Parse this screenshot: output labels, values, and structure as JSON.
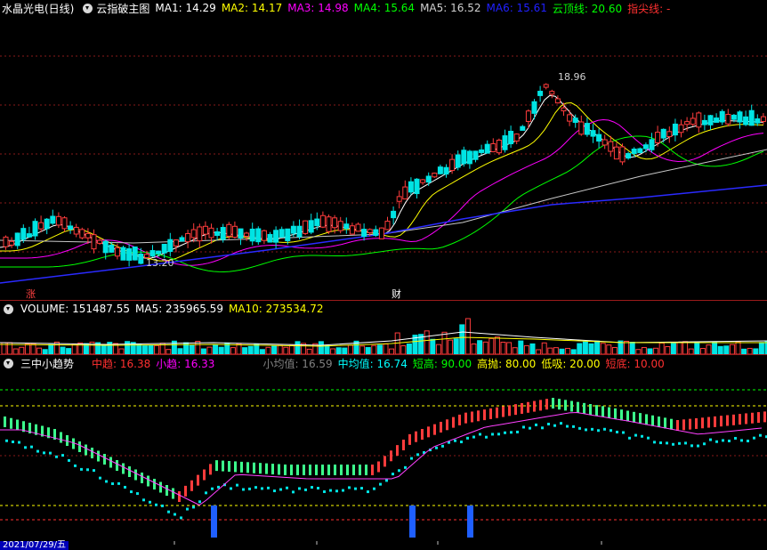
{
  "header": {
    "stock_name": "水晶光电(日线)",
    "indicator_name": "云指破主图",
    "items": [
      {
        "label": "MA1: 14.29",
        "color": "#ffffff"
      },
      {
        "label": "MA2: 14.17",
        "color": "#ffff00"
      },
      {
        "label": "MA3: 14.98",
        "color": "#ff00ff"
      },
      {
        "label": "MA4: 15.64",
        "color": "#00ff00"
      },
      {
        "label": "MA5: 16.52",
        "color": "#d0d0d0"
      },
      {
        "label": "MA6: 15.61",
        "color": "#2020ff"
      },
      {
        "label": "云顶线: 20.60",
        "color": "#00ff00"
      },
      {
        "label": "指尖线: -",
        "color": "#ff3030"
      }
    ]
  },
  "main_chart": {
    "high_label": "18.96",
    "low_label": "13.20",
    "marker_zhang": "涨",
    "marker_cai": "财"
  },
  "volume_panel": {
    "items": [
      {
        "label": "VOLUME: 151487.55",
        "color": "#ffffff"
      },
      {
        "label": "MA5: 235965.59",
        "color": "#ffffff"
      },
      {
        "label": "MA10: 273534.72",
        "color": "#ffff00"
      }
    ]
  },
  "indicator_panel": {
    "name": "三中小趋势",
    "items": [
      {
        "label": "中趋: 16.38",
        "color": "#ff3030"
      },
      {
        "label": "小趋: 16.33",
        "color": "#ff00ff"
      },
      {
        "label": "小均值: 16.59",
        "color": "#808080"
      },
      {
        "label": "中均值: 16.74",
        "color": "#00ffff"
      },
      {
        "label": "短高: 90.00",
        "color": "#00ff00"
      },
      {
        "label": "高抛: 80.00",
        "color": "#ffff00"
      },
      {
        "label": "低吸: 20.00",
        "color": "#ffff00"
      },
      {
        "label": "短底: 10.00",
        "color": "#ff3030"
      }
    ]
  },
  "axis": {
    "date": "2021/07/29/五"
  },
  "colors": {
    "up": "#ff3c3c",
    "down": "#00e4e4",
    "separator": "#9b1b1b"
  }
}
